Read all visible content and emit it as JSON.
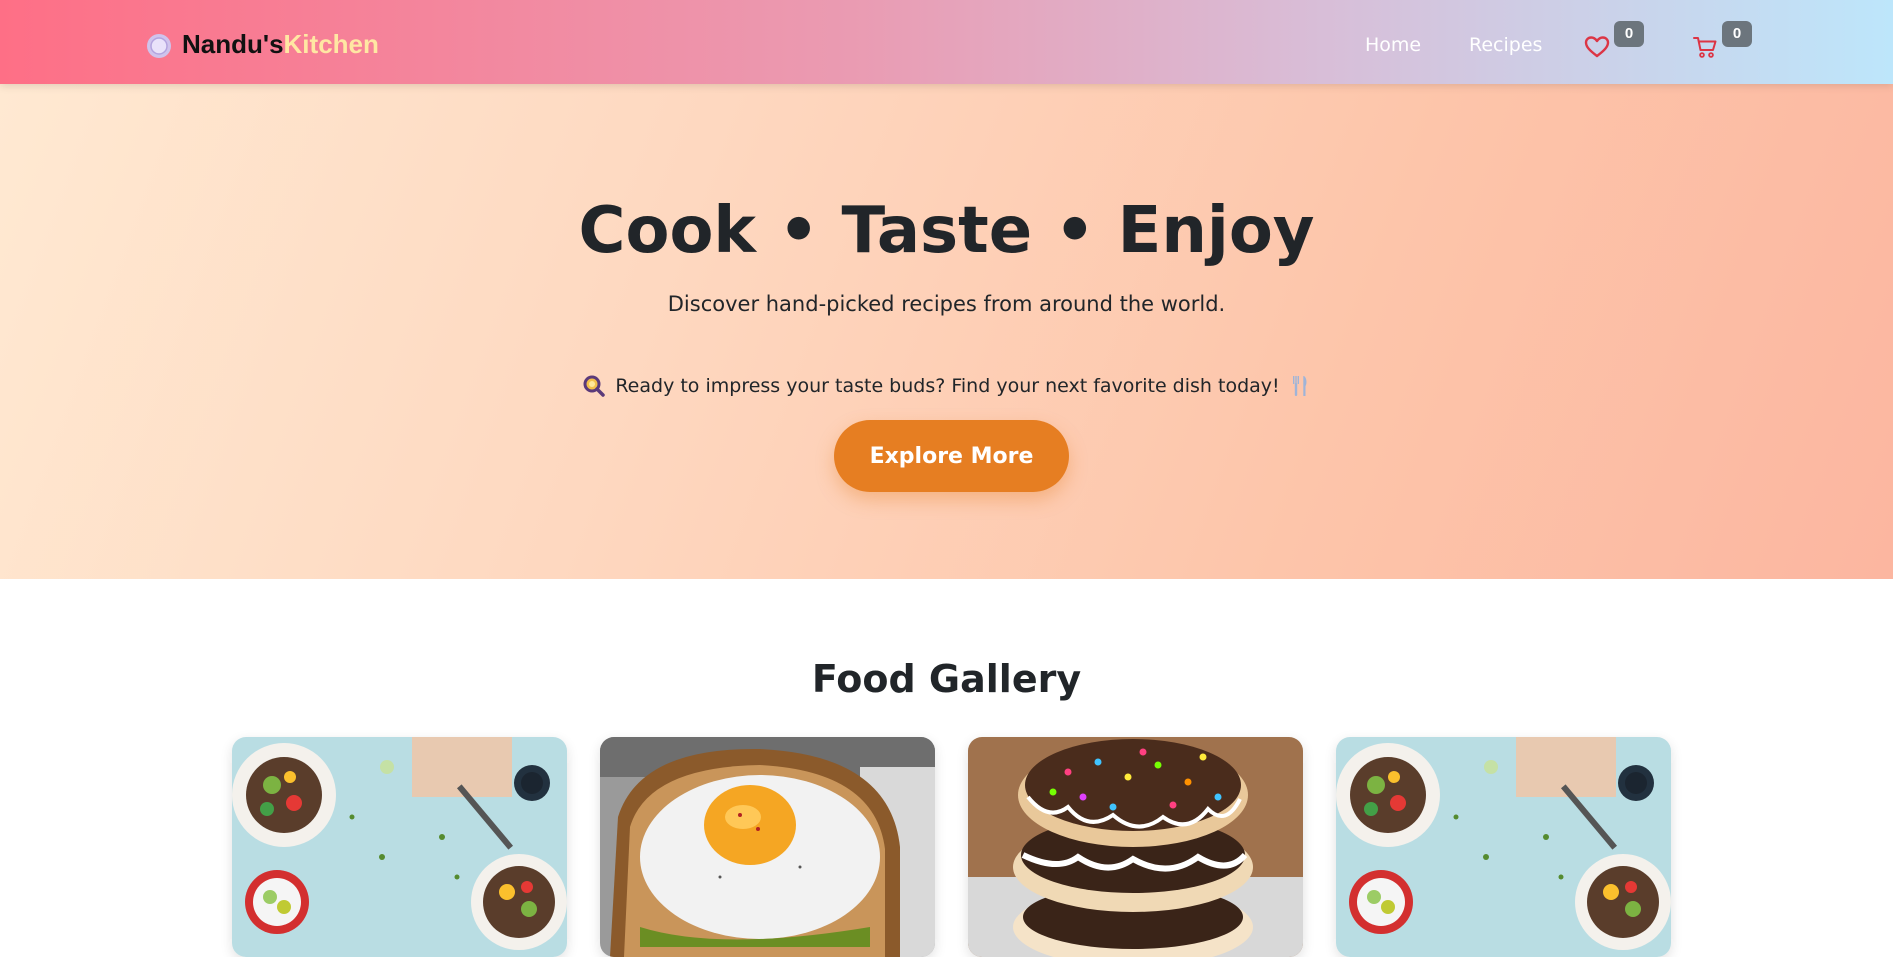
{
  "navbar": {
    "brand_main": "Nandu's",
    "brand_accent": "Kitchen",
    "brand_icon": "plate-icon",
    "links": [
      {
        "label": "Home"
      },
      {
        "label": "Recipes"
      }
    ],
    "favorites": {
      "icon": "heart-icon",
      "count": "0"
    },
    "cart": {
      "icon": "cart-icon",
      "count": "0"
    }
  },
  "hero": {
    "title": "Cook • Taste • Enjoy",
    "subtitle": "Discover hand-picked recipes from around the world.",
    "cta_text": "Ready to impress your taste buds? Find your next favorite dish today!",
    "cta_icon_left": "magnifier-icon",
    "cta_icon_right": "fork-knife-icon",
    "button_label": "Explore More"
  },
  "gallery": {
    "title": "Food Gallery",
    "items": [
      {
        "subject": "salad-bowls-photo"
      },
      {
        "subject": "fried-egg-toast-photo"
      },
      {
        "subject": "sprinkle-donuts-photo"
      },
      {
        "subject": "salad-bowls-photo"
      }
    ]
  },
  "colors": {
    "accent_button": "#e67e22",
    "brand_accent": "#ffe7a3",
    "badge": "#6c757d",
    "icon_red": "#dc3545"
  }
}
